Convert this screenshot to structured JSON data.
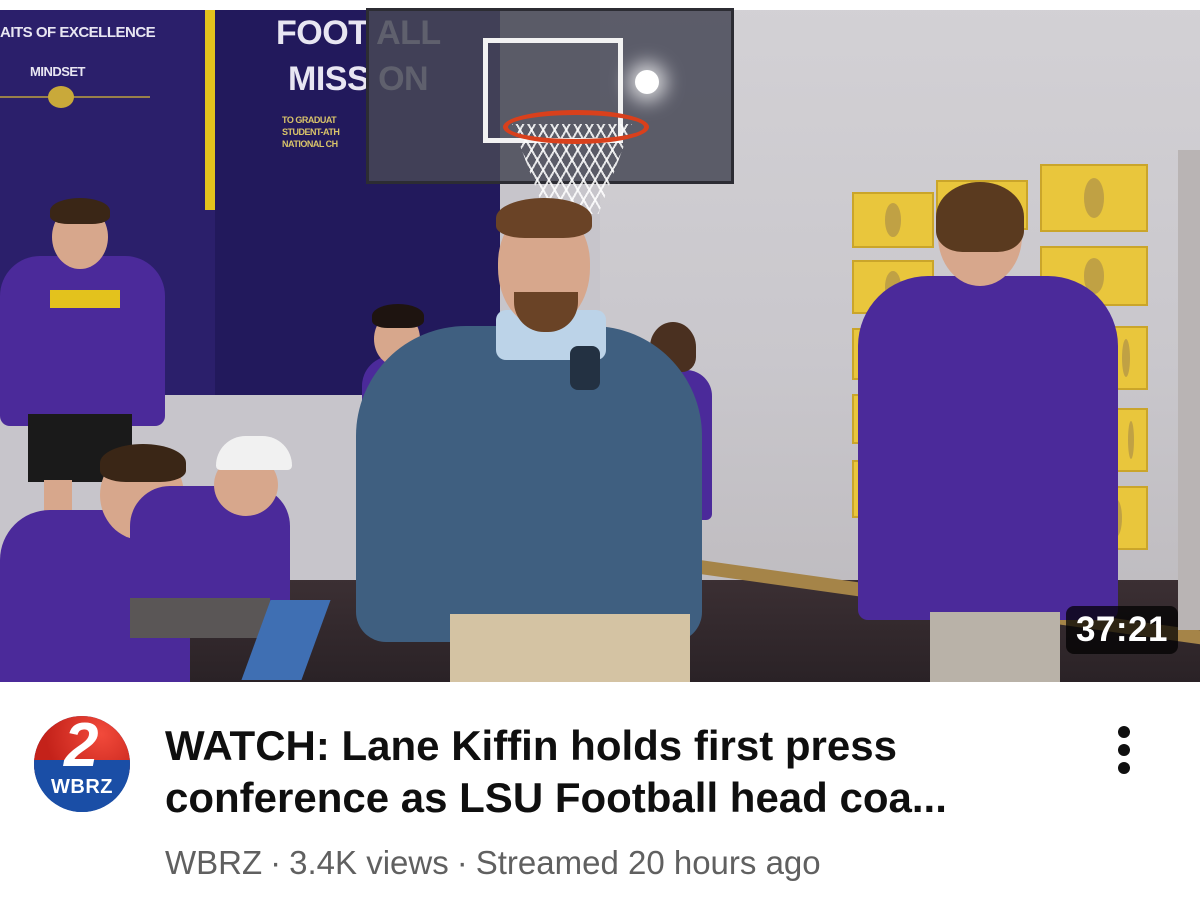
{
  "video": {
    "duration": "37:21",
    "thumbnail": {
      "banner_pillars": "AITS OF EXCELLENCE",
      "banner_mindset": "MINDSET",
      "banner_foot": "FOOT   ALL",
      "banner_mission": "MISS   ON",
      "banner_small_1": "TO GRADUAT",
      "banner_small_2": "STUDENT-ATH",
      "banner_small_3": "NATIONAL CH"
    },
    "title": "WATCH: Lane Kiffin holds first press conference as LSU Football head coa...",
    "channel": {
      "avatar_number": "2",
      "avatar_brand": "WBRZ",
      "name": "WBRZ"
    },
    "views": "3.4K views",
    "streamed": "Streamed 20 hours ago",
    "separator": "·",
    "more_icon": "more-vertical-icon"
  }
}
